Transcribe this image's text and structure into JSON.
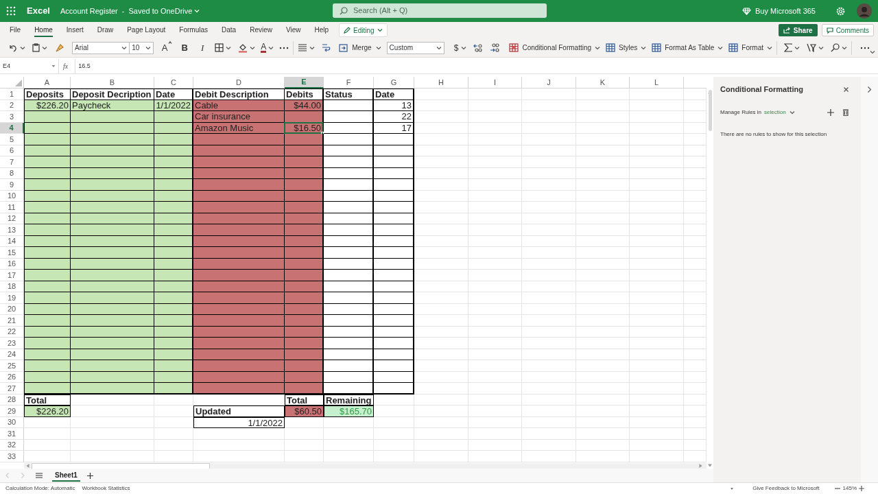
{
  "app_bar": {
    "app_name": "Excel",
    "document": "Account Register",
    "title_separator": "-",
    "save_status": "Saved to OneDrive",
    "search_placeholder": "Search (Alt + Q)",
    "buy_link": "Buy Microsoft 365"
  },
  "ribbon_tabs": [
    {
      "label": "File",
      "selected": false
    },
    {
      "label": "Home",
      "selected": true
    },
    {
      "label": "Insert",
      "selected": false
    },
    {
      "label": "Draw",
      "selected": false
    },
    {
      "label": "Page Layout",
      "selected": false
    },
    {
      "label": "Formulas",
      "selected": false
    },
    {
      "label": "Data",
      "selected": false
    },
    {
      "label": "Review",
      "selected": false
    },
    {
      "label": "View",
      "selected": false
    },
    {
      "label": "Help",
      "selected": false
    }
  ],
  "mode_button": "Editing",
  "share_button": "Share",
  "comments_button": "Comments",
  "toolbar": {
    "font": "Arial",
    "font_size": "10",
    "bold": "B",
    "italic": "I",
    "font_color": "A",
    "grow_font": "A",
    "merge": "Merge",
    "number_format": "Custom",
    "currency": "$",
    "conditional_formatting": "Conditional Formatting",
    "styles": "Styles",
    "format_as_table": "Format As Table",
    "format": "Format"
  },
  "formula_bar": {
    "name_box": "E4",
    "fx": "fx",
    "value": "16.5"
  },
  "columns": [
    {
      "label": "A",
      "selected": false
    },
    {
      "label": "B",
      "selected": false
    },
    {
      "label": "C",
      "selected": false
    },
    {
      "label": "D",
      "selected": false
    },
    {
      "label": "E",
      "selected": true
    },
    {
      "label": "F",
      "selected": false
    },
    {
      "label": "G",
      "selected": false
    },
    {
      "label": "H",
      "selected": false
    },
    {
      "label": "I",
      "selected": false
    },
    {
      "label": "J",
      "selected": false
    },
    {
      "label": "K",
      "selected": false
    },
    {
      "label": "L",
      "selected": false
    }
  ],
  "rows": [
    {
      "number": "1",
      "selected": false,
      "cells": [
        {
          "text": "Deposits",
          "bold": true
        },
        {
          "text": "Deposit Decription",
          "bold": true
        },
        {
          "text": "Date",
          "bold": true
        },
        {
          "text": "Debit Description",
          "bold": true
        },
        {
          "text": "Debits",
          "bold": true
        },
        {
          "text": "Status",
          "bold": true
        },
        {
          "text": "Date",
          "bold": true
        }
      ]
    },
    {
      "number": "2",
      "selected": false,
      "cells": [
        {
          "text": "$226.20",
          "kind": "number",
          "color": "#c6e7b5"
        },
        {
          "text": "Paycheck",
          "color": "#c6e7b5"
        },
        {
          "text": "1/1/2022",
          "kind": "number",
          "color": "#c6e7b5"
        },
        {
          "text": "Cable",
          "color": "#c97273"
        },
        {
          "text": "$44.00",
          "kind": "number",
          "color": "#c97273"
        },
        {},
        {
          "text": "13",
          "kind": "number"
        }
      ]
    },
    {
      "number": "3",
      "selected": false,
      "cells": [
        {
          "color": "#c6e7b5"
        },
        {
          "color": "#c6e7b5"
        },
        {
          "color": "#c6e7b5"
        },
        {
          "text": "Car insurance",
          "color": "#c97273"
        },
        {
          "color": "#c97273"
        },
        {},
        {
          "text": "22",
          "kind": "number"
        }
      ]
    },
    {
      "number": "4",
      "selected": true,
      "cells": [
        {
          "color": "#c6e7b5"
        },
        {
          "color": "#c6e7b5"
        },
        {
          "color": "#c6e7b5"
        },
        {
          "text": "Amazon Music",
          "color": "#c97273"
        },
        {
          "text": "$16.50",
          "kind": "number",
          "color": "#c97273"
        },
        {},
        {
          "text": "17",
          "kind": "number"
        }
      ]
    },
    {
      "number": "5",
      "selected": false,
      "cells": [
        {
          "color": "#c6e7b5"
        },
        {
          "color": "#c6e7b5"
        },
        {
          "color": "#c6e7b5"
        },
        {
          "color": "#c97273"
        },
        {
          "color": "#c97273"
        },
        {},
        {}
      ]
    },
    {
      "number": "6",
      "selected": false,
      "cells": [
        {
          "color": "#c6e7b5"
        },
        {
          "color": "#c6e7b5"
        },
        {
          "color": "#c6e7b5"
        },
        {
          "color": "#c97273"
        },
        {
          "color": "#c97273"
        },
        {},
        {}
      ]
    },
    {
      "number": "7",
      "selected": false,
      "cells": [
        {
          "color": "#c6e7b5"
        },
        {
          "color": "#c6e7b5"
        },
        {
          "color": "#c6e7b5"
        },
        {
          "color": "#c97273"
        },
        {
          "color": "#c97273"
        },
        {},
        {}
      ]
    },
    {
      "number": "8",
      "selected": false,
      "cells": [
        {
          "color": "#c6e7b5"
        },
        {
          "color": "#c6e7b5"
        },
        {
          "color": "#c6e7b5"
        },
        {
          "color": "#c97273"
        },
        {
          "color": "#c97273"
        },
        {},
        {}
      ]
    },
    {
      "number": "9",
      "selected": false,
      "cells": [
        {
          "color": "#c6e7b5"
        },
        {
          "color": "#c6e7b5"
        },
        {
          "color": "#c6e7b5"
        },
        {
          "color": "#c97273"
        },
        {
          "color": "#c97273"
        },
        {},
        {}
      ]
    },
    {
      "number": "10",
      "selected": false,
      "cells": [
        {
          "color": "#c6e7b5"
        },
        {
          "color": "#c6e7b5"
        },
        {
          "color": "#c6e7b5"
        },
        {
          "color": "#c97273"
        },
        {
          "color": "#c97273"
        },
        {},
        {}
      ]
    },
    {
      "number": "11",
      "selected": false,
      "cells": [
        {
          "color": "#c6e7b5"
        },
        {
          "color": "#c6e7b5"
        },
        {
          "color": "#c6e7b5"
        },
        {
          "color": "#c97273"
        },
        {
          "color": "#c97273"
        },
        {},
        {}
      ]
    },
    {
      "number": "12",
      "selected": false,
      "cells": [
        {
          "color": "#c6e7b5"
        },
        {
          "color": "#c6e7b5"
        },
        {
          "color": "#c6e7b5"
        },
        {
          "color": "#c97273"
        },
        {
          "color": "#c97273"
        },
        {},
        {}
      ]
    },
    {
      "number": "13",
      "selected": false,
      "cells": [
        {
          "color": "#c6e7b5"
        },
        {
          "color": "#c6e7b5"
        },
        {
          "color": "#c6e7b5"
        },
        {
          "color": "#c97273"
        },
        {
          "color": "#c97273"
        },
        {},
        {}
      ]
    },
    {
      "number": "14",
      "selected": false,
      "cells": [
        {
          "color": "#c6e7b5"
        },
        {
          "color": "#c6e7b5"
        },
        {
          "color": "#c6e7b5"
        },
        {
          "color": "#c97273"
        },
        {
          "color": "#c97273"
        },
        {},
        {}
      ]
    },
    {
      "number": "15",
      "selected": false,
      "cells": [
        {
          "color": "#c6e7b5"
        },
        {
          "color": "#c6e7b5"
        },
        {
          "color": "#c6e7b5"
        },
        {
          "color": "#c97273"
        },
        {
          "color": "#c97273"
        },
        {},
        {}
      ]
    },
    {
      "number": "16",
      "selected": false,
      "cells": [
        {
          "color": "#c6e7b5"
        },
        {
          "color": "#c6e7b5"
        },
        {
          "color": "#c6e7b5"
        },
        {
          "color": "#c97273"
        },
        {
          "color": "#c97273"
        },
        {},
        {}
      ]
    },
    {
      "number": "17",
      "selected": false,
      "cells": [
        {
          "color": "#c6e7b5"
        },
        {
          "color": "#c6e7b5"
        },
        {
          "color": "#c6e7b5"
        },
        {
          "color": "#c97273"
        },
        {
          "color": "#c97273"
        },
        {},
        {}
      ]
    },
    {
      "number": "18",
      "selected": false,
      "cells": [
        {
          "color": "#c6e7b5"
        },
        {
          "color": "#c6e7b5"
        },
        {
          "color": "#c6e7b5"
        },
        {
          "color": "#c97273"
        },
        {
          "color": "#c97273"
        },
        {},
        {}
      ]
    },
    {
      "number": "19",
      "selected": false,
      "cells": [
        {
          "color": "#c6e7b5"
        },
        {
          "color": "#c6e7b5"
        },
        {
          "color": "#c6e7b5"
        },
        {
          "color": "#c97273"
        },
        {
          "color": "#c97273"
        },
        {},
        {}
      ]
    },
    {
      "number": "20",
      "selected": false,
      "cells": [
        {
          "color": "#c6e7b5"
        },
        {
          "color": "#c6e7b5"
        },
        {
          "color": "#c6e7b5"
        },
        {
          "color": "#c97273"
        },
        {
          "color": "#c97273"
        },
        {},
        {}
      ]
    },
    {
      "number": "21",
      "selected": false,
      "cells": [
        {
          "color": "#c6e7b5"
        },
        {
          "color": "#c6e7b5"
        },
        {
          "color": "#c6e7b5"
        },
        {
          "color": "#c97273"
        },
        {
          "color": "#c97273"
        },
        {},
        {}
      ]
    },
    {
      "number": "22",
      "selected": false,
      "cells": [
        {
          "color": "#c6e7b5"
        },
        {
          "color": "#c6e7b5"
        },
        {
          "color": "#c6e7b5"
        },
        {
          "color": "#c97273"
        },
        {
          "color": "#c97273"
        },
        {},
        {}
      ]
    },
    {
      "number": "23",
      "selected": false,
      "cells": [
        {
          "color": "#c6e7b5"
        },
        {
          "color": "#c6e7b5"
        },
        {
          "color": "#c6e7b5"
        },
        {
          "color": "#c97273"
        },
        {
          "color": "#c97273"
        },
        {},
        {}
      ]
    },
    {
      "number": "24",
      "selected": false,
      "cells": [
        {
          "color": "#c6e7b5"
        },
        {
          "color": "#c6e7b5"
        },
        {
          "color": "#c6e7b5"
        },
        {
          "color": "#c97273"
        },
        {
          "color": "#c97273"
        },
        {},
        {}
      ]
    },
    {
      "number": "25",
      "selected": false,
      "cells": [
        {
          "color": "#c6e7b5"
        },
        {
          "color": "#c6e7b5"
        },
        {
          "color": "#c6e7b5"
        },
        {
          "color": "#c97273"
        },
        {
          "color": "#c97273"
        },
        {},
        {}
      ]
    },
    {
      "number": "26",
      "selected": false,
      "cells": [
        {
          "color": "#c6e7b5"
        },
        {
          "color": "#c6e7b5"
        },
        {
          "color": "#c6e7b5"
        },
        {
          "color": "#c97273"
        },
        {
          "color": "#c97273"
        },
        {},
        {}
      ]
    },
    {
      "number": "27",
      "selected": false,
      "cells": [
        {
          "color": "#c6e7b5"
        },
        {
          "color": "#c6e7b5"
        },
        {
          "color": "#c6e7b5"
        },
        {
          "color": "#c97273"
        },
        {
          "color": "#c97273"
        },
        {},
        {}
      ]
    },
    {
      "number": "28",
      "selected": false,
      "cells": [
        {
          "text": "Total",
          "bold": true
        },
        {},
        {},
        {},
        {
          "text": "Total",
          "bold": true
        },
        {
          "text": "Remaining",
          "bold": true
        }
      ]
    },
    {
      "number": "29",
      "selected": false,
      "cells": [
        {
          "text": "$226.20",
          "kind": "number",
          "color": "#c6e7b5"
        },
        {},
        {},
        {
          "text": "Updated",
          "bold": true
        },
        {
          "text": "$60.50",
          "kind": "number",
          "color": "#c97273"
        },
        {
          "text": "$165.70",
          "kind": "gain",
          "color": "#c6efce"
        }
      ]
    },
    {
      "number": "30",
      "selected": false,
      "cells": [
        {},
        {},
        {},
        {
          "text": "1/1/2022",
          "kind": "number"
        }
      ]
    },
    {
      "number": "31",
      "selected": false,
      "cells": []
    },
    {
      "number": "32",
      "selected": false,
      "cells": []
    },
    {
      "number": "33",
      "selected": false,
      "cells": []
    }
  ],
  "sheet_tabs": [
    {
      "label": "Sheet1",
      "selected": true
    }
  ],
  "side_panel": {
    "title": "Conditional Formatting",
    "manage_label": "Manage Rules in",
    "scope": "selection",
    "empty_message": "There are no rules to show for this selection"
  },
  "status_bar": {
    "calculation_mode": "Calculation Mode: Automatic",
    "statistics": "Workbook Statistics",
    "feedback": "Give Feedback to Microsoft",
    "zoom": "145%"
  }
}
